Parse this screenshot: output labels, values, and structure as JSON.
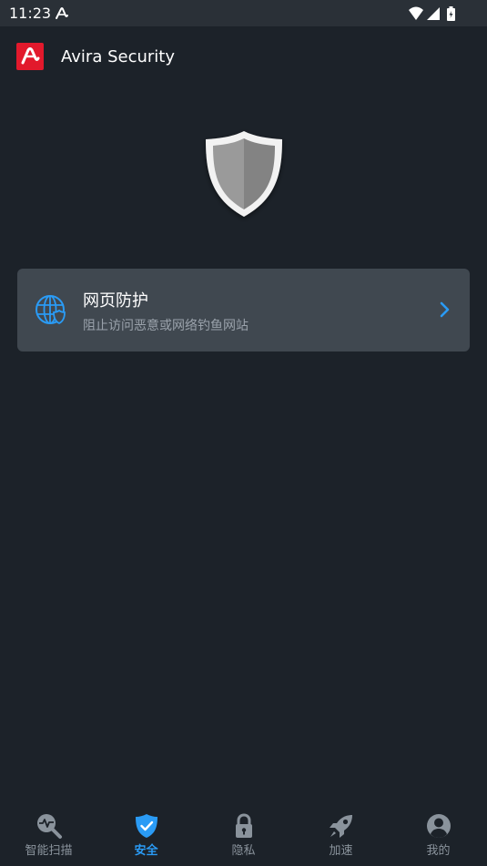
{
  "status_bar": {
    "time": "11:23"
  },
  "app": {
    "title": "Avira Security",
    "brand_color": "#e2192c"
  },
  "card": {
    "title": "网页防护",
    "subtitle": "阻止访问恶意或网络钓鱼网站",
    "icon": "globe-shield-icon",
    "accent": "#2a9bf5"
  },
  "bottom_nav": {
    "items": [
      {
        "label": "智能扫描",
        "icon": "scan-icon",
        "active": false
      },
      {
        "label": "安全",
        "icon": "shield-check-icon",
        "active": true
      },
      {
        "label": "隐私",
        "icon": "lock-icon",
        "active": false
      },
      {
        "label": "加速",
        "icon": "rocket-icon",
        "active": false
      },
      {
        "label": "我的",
        "icon": "profile-icon",
        "active": false
      }
    ]
  }
}
